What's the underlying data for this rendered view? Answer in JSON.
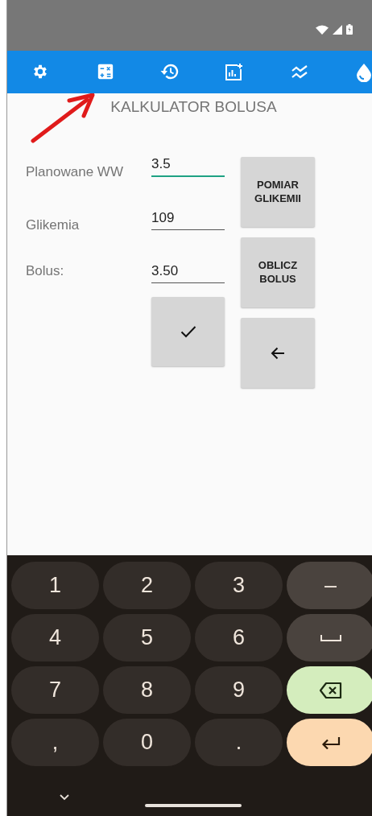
{
  "title": "KALKULATOR BOLUSA",
  "fields": [
    {
      "label": "Planowane WW",
      "value": "3.5",
      "focused": true
    },
    {
      "label": "Glikemia",
      "value": "109",
      "focused": false
    },
    {
      "label": "Bolus:",
      "value": "3.50",
      "focused": false
    }
  ],
  "side_buttons": [
    "POMIAR GLIKEMII",
    "OBLICZ BOLUS"
  ],
  "keyboard": [
    {
      "kind": "char",
      "label": "1"
    },
    {
      "kind": "char",
      "label": "2"
    },
    {
      "kind": "char",
      "label": "3"
    },
    {
      "kind": "function",
      "label": "–"
    },
    {
      "kind": "char",
      "label": "4"
    },
    {
      "kind": "char",
      "label": "5"
    },
    {
      "kind": "char",
      "label": "6"
    },
    {
      "kind": "space"
    },
    {
      "kind": "char",
      "label": "7"
    },
    {
      "kind": "char",
      "label": "8"
    },
    {
      "kind": "char",
      "label": "9"
    },
    {
      "kind": "delete"
    },
    {
      "kind": "char",
      "label": ","
    },
    {
      "kind": "char",
      "label": "0"
    },
    {
      "kind": "char",
      "label": "."
    },
    {
      "kind": "enter"
    }
  ]
}
